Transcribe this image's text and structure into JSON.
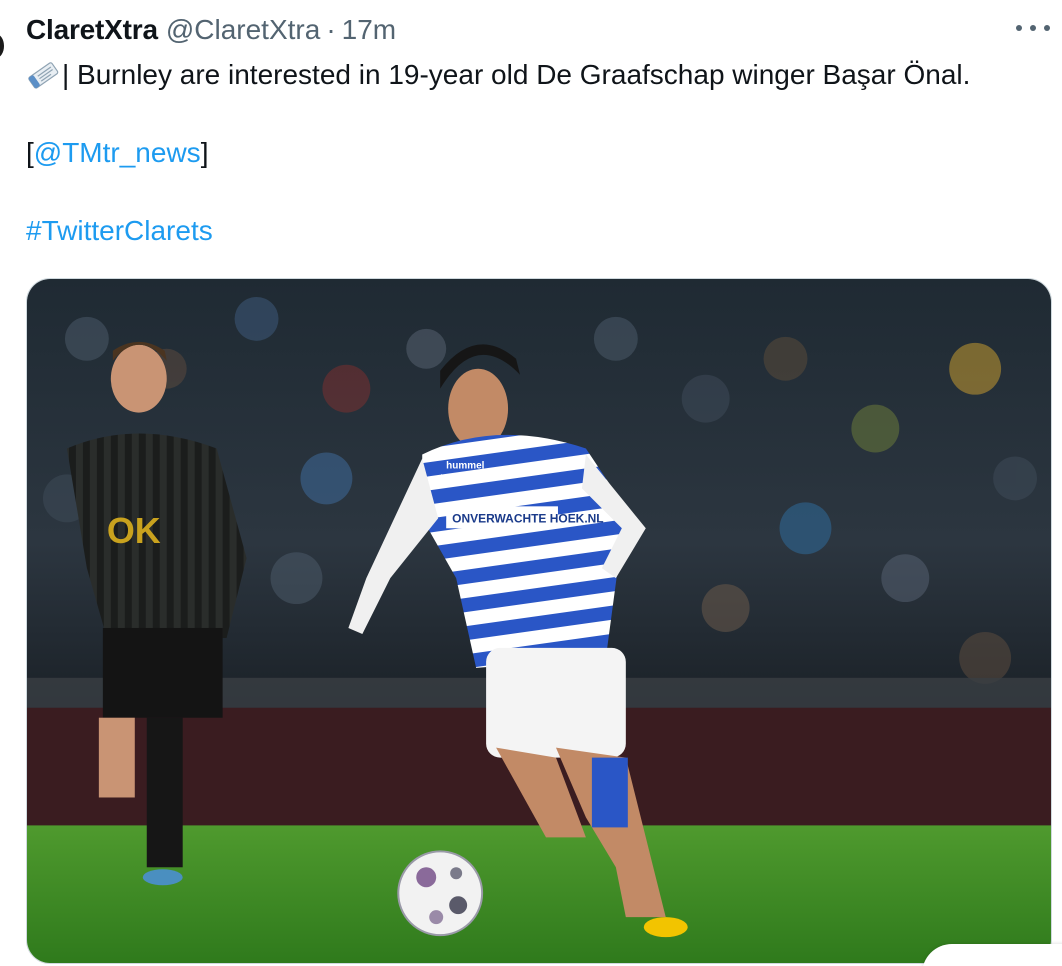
{
  "tweet": {
    "display_name": "ClaretXtra",
    "handle": "@ClaretXtra",
    "separator": "·",
    "time": "17m",
    "text_line1": "| Burnley are interested in 19-year old De Graafschap winger Başar Önal.",
    "mention_open": "[",
    "mention": "@TMtr_news",
    "mention_close": "]",
    "hashtag": "#TwitterClarets",
    "icons": {
      "leading": "newspaper-icon",
      "menu": "more-dots-icon"
    },
    "colors": {
      "text": "#0f1419",
      "secondary": "#536471",
      "link": "#1d9bf0"
    }
  },
  "media": {
    "kit_sponsor": "ONVERWACHTE HOEK.NL",
    "kit_brand": "hummel"
  }
}
